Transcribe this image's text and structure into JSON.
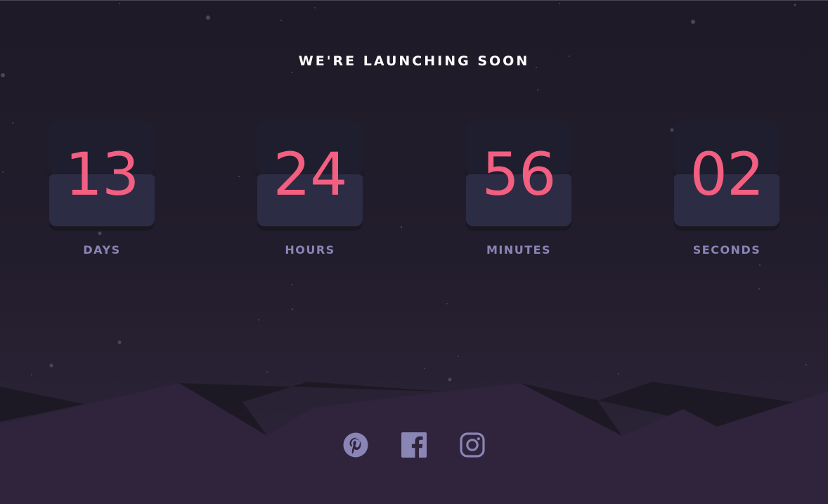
{
  "header": {
    "title": "WE'RE LAUNCHING SOON"
  },
  "countdown": {
    "units": [
      {
        "value": "13",
        "label": "DAYS"
      },
      {
        "value": "24",
        "label": "HOURS"
      },
      {
        "value": "56",
        "label": "MINUTES"
      },
      {
        "value": "02",
        "label": "SECONDS"
      }
    ]
  },
  "social": {
    "icons": [
      "pinterest-icon",
      "facebook-icon",
      "instagram-icon"
    ]
  },
  "colors": {
    "accent": "#f25f81",
    "label": "#8985b5",
    "icon": "#8985b5",
    "card_top": "#1f1e2e",
    "card_bottom": "#2c2c44",
    "hills": "#30233c",
    "background": "#1e1a27"
  }
}
